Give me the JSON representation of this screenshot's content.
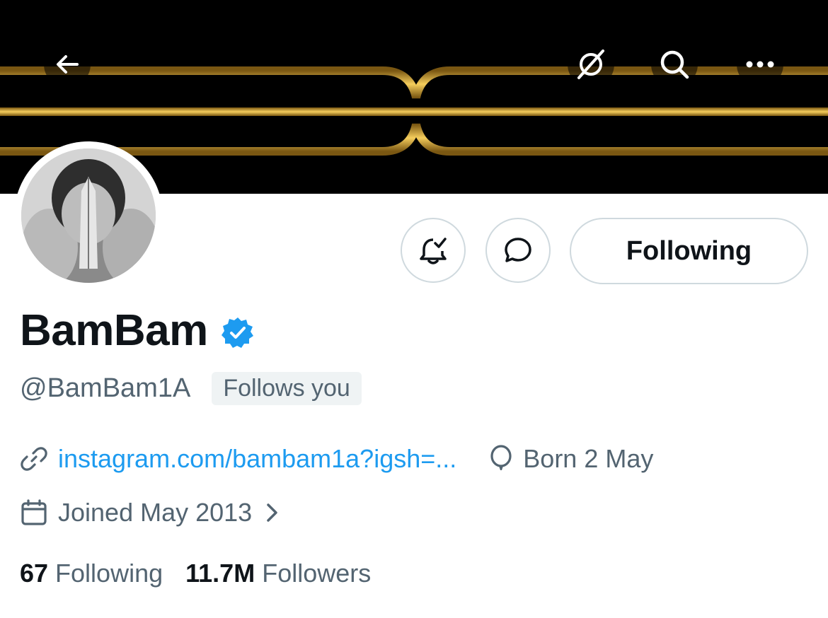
{
  "header": {
    "back_icon": "arrow-left-icon",
    "grok_icon": "grok-icon",
    "search_icon": "search-icon",
    "more_icon": "more-icon"
  },
  "profile": {
    "name": "BamBam",
    "handle": "@BamBam1A",
    "follows_you": "Follows you",
    "website": "instagram.com/bambam1a?igsh=...",
    "birthday": "Born 2 May",
    "joined": "Joined May 2013",
    "following_count": "67",
    "following_label": "Following",
    "followers_count": "11.7M",
    "followers_label": "Followers"
  },
  "actions": {
    "following_button": "Following"
  },
  "colors": {
    "accent_link": "#1d9bf0",
    "verified_badge": "#1d9bf0",
    "secondary_text": "#536471",
    "primary_text": "#0f1419",
    "banner_gold": "#e0a93a"
  }
}
